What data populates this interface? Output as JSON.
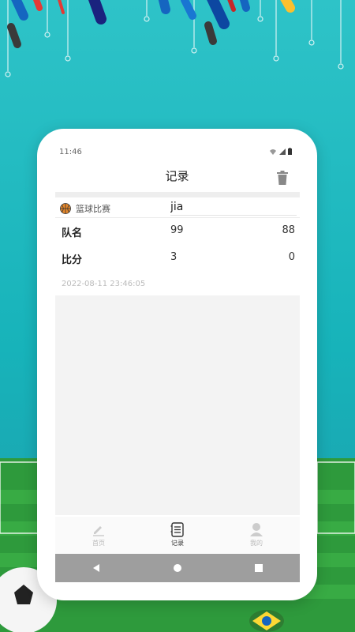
{
  "status_bar": {
    "time": "11:46"
  },
  "header": {
    "title": "记录",
    "delete_icon": "trash-icon"
  },
  "record": {
    "game_type": "篮球比赛",
    "game_icon": "basketball-icon",
    "team_name": "jia",
    "rows": [
      {
        "label": "队名",
        "left": "99",
        "right": "88"
      },
      {
        "label": "比分",
        "left": "3",
        "right": "0"
      }
    ],
    "timestamp": "2022-08-11 23:46:05"
  },
  "bottom_nav": [
    {
      "label": "首页",
      "icon": "edit-icon",
      "active": false
    },
    {
      "label": "记录",
      "icon": "list-icon",
      "active": true
    },
    {
      "label": "我的",
      "icon": "person-icon",
      "active": false
    }
  ],
  "system_nav": [
    "back-icon",
    "home-icon",
    "recents-icon"
  ],
  "colors": {
    "background": "#1ab5bc",
    "accent_dark": "#222222",
    "muted": "#bbbbbb"
  }
}
